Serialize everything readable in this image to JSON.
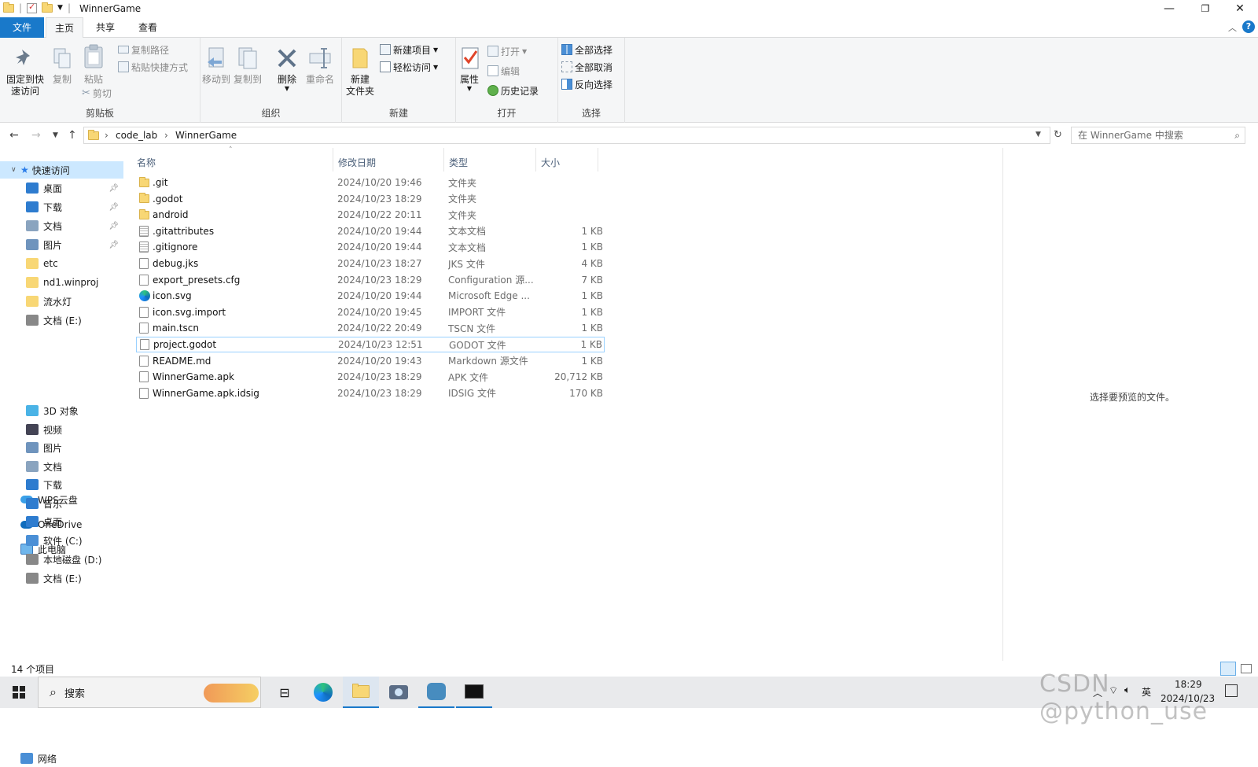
{
  "window": {
    "title": "WinnerGame",
    "minimize": "—",
    "maximize": "❐",
    "close": "✕"
  },
  "tabs": {
    "file": "文件",
    "home": "主页",
    "share": "共享",
    "view": "查看"
  },
  "ribbon": {
    "clipboard": {
      "label": "剪贴板",
      "pin_line1": "固定到快",
      "pin_line2": "速访问",
      "copy": "复制",
      "paste": "粘贴",
      "copy_path": "复制路径",
      "paste_shortcut": "粘贴快捷方式",
      "cut": "剪切"
    },
    "organize": {
      "label": "组织",
      "move_to": "移动到",
      "copy_to": "复制到",
      "delete": "删除",
      "rename": "重命名"
    },
    "new": {
      "label": "新建",
      "new_folder_line1": "新建",
      "new_folder_line2": "文件夹",
      "new_item": "新建项目",
      "easy_access": "轻松访问"
    },
    "open": {
      "label": "打开",
      "properties": "属性",
      "open": "打开",
      "edit": "编辑",
      "history": "历史记录"
    },
    "select": {
      "label": "选择",
      "select_all": "全部选择",
      "select_none": "全部取消",
      "invert": "反向选择"
    }
  },
  "address": {
    "crumbs": [
      "code_lab",
      "WinnerGame"
    ],
    "search_placeholder": "在 WinnerGame 中搜索"
  },
  "sidebar": {
    "quick_access": "快速访问",
    "quick_items": [
      {
        "label": "桌面",
        "pinned": true
      },
      {
        "label": "下载",
        "pinned": true
      },
      {
        "label": "文档",
        "pinned": true
      },
      {
        "label": "图片",
        "pinned": true
      },
      {
        "label": "etc",
        "pinned": false
      },
      {
        "label": "nd1.winproj",
        "pinned": false
      },
      {
        "label": "流水灯",
        "pinned": false
      },
      {
        "label": "文档 (E:)",
        "pinned": false
      }
    ],
    "wps": "WPS云盘",
    "onedrive": "OneDrive",
    "this_pc": "此电脑",
    "pc_items": [
      "3D 对象",
      "视频",
      "图片",
      "文档",
      "下载",
      "音乐",
      "桌面",
      "软件 (C:)",
      "本地磁盘 (D:)",
      "文档 (E:)"
    ],
    "network": "网络"
  },
  "columns": {
    "name": "名称",
    "date": "修改日期",
    "type": "类型",
    "size": "大小"
  },
  "files": [
    {
      "name": ".git",
      "date": "2024/10/20 19:46",
      "type": "文件夹",
      "size": "",
      "kind": "folder"
    },
    {
      "name": ".godot",
      "date": "2024/10/23 18:29",
      "type": "文件夹",
      "size": "",
      "kind": "folder"
    },
    {
      "name": "android",
      "date": "2024/10/22 20:11",
      "type": "文件夹",
      "size": "",
      "kind": "folder"
    },
    {
      "name": ".gitattributes",
      "date": "2024/10/20 19:44",
      "type": "文本文档",
      "size": "1 KB",
      "kind": "text"
    },
    {
      "name": ".gitignore",
      "date": "2024/10/20 19:44",
      "type": "文本文档",
      "size": "1 KB",
      "kind": "text"
    },
    {
      "name": "debug.jks",
      "date": "2024/10/23 18:27",
      "type": "JKS 文件",
      "size": "4 KB",
      "kind": "doc"
    },
    {
      "name": "export_presets.cfg",
      "date": "2024/10/23 18:29",
      "type": "Configuration 源...",
      "size": "7 KB",
      "kind": "cfg"
    },
    {
      "name": "icon.svg",
      "date": "2024/10/20 19:44",
      "type": "Microsoft Edge ...",
      "size": "1 KB",
      "kind": "edge"
    },
    {
      "name": "icon.svg.import",
      "date": "2024/10/20 19:45",
      "type": "IMPORT 文件",
      "size": "1 KB",
      "kind": "doc"
    },
    {
      "name": "main.tscn",
      "date": "2024/10/22 20:49",
      "type": "TSCN 文件",
      "size": "1 KB",
      "kind": "doc"
    },
    {
      "name": "project.godot",
      "date": "2024/10/23 12:51",
      "type": "GODOT 文件",
      "size": "1 KB",
      "kind": "doc"
    },
    {
      "name": "README.md",
      "date": "2024/10/20 19:43",
      "type": "Markdown 源文件",
      "size": "1 KB",
      "kind": "md"
    },
    {
      "name": "WinnerGame.apk",
      "date": "2024/10/23 18:29",
      "type": "APK 文件",
      "size": "20,712 KB",
      "kind": "doc"
    },
    {
      "name": "WinnerGame.apk.idsig",
      "date": "2024/10/23 18:29",
      "type": "IDSIG 文件",
      "size": "170 KB",
      "kind": "doc"
    }
  ],
  "selected_file": "project.godot",
  "preview_text": "选择要预览的文件。",
  "status": {
    "count": "14 个项目"
  },
  "taskbar": {
    "search": "搜索",
    "time": "18:29",
    "date": "2024/10/23",
    "ime": "英"
  },
  "watermark": "CSDN @python_use",
  "colors": {
    "accent": "#1979ca",
    "folder": "#f8d775",
    "ribbon_bg": "#f5f6f7",
    "selection_border": "#99d1ff"
  }
}
